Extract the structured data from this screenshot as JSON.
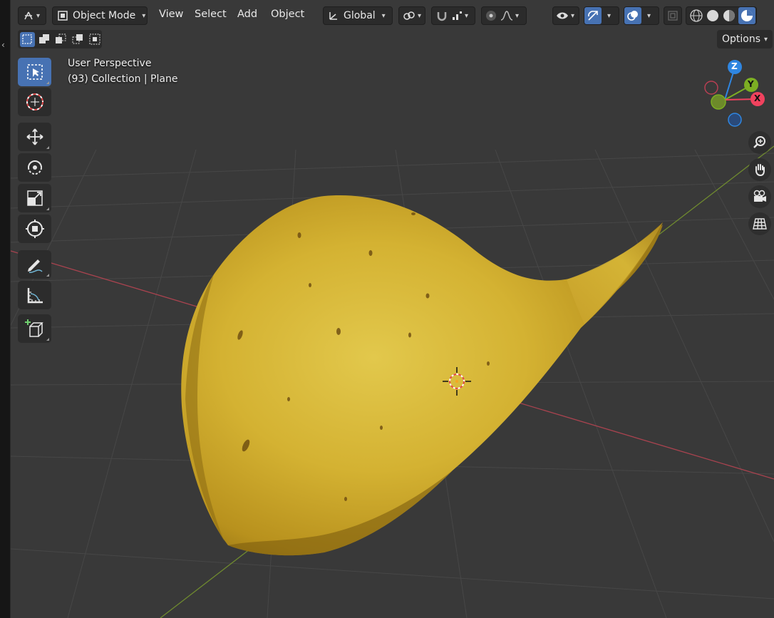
{
  "header": {
    "mode_label": "Object Mode",
    "menus": [
      "View",
      "Select",
      "Add",
      "Object"
    ],
    "orientation_label": "Global",
    "options_label": "Options"
  },
  "overlay": {
    "view_name": "User Perspective",
    "collection_info": "(93) Collection | Plane"
  },
  "gizmo": {
    "z_label": "Z",
    "y_label": "Y",
    "x_label": "X",
    "colors": {
      "x": "#f0425e",
      "y": "#7cae23",
      "z": "#2f86e1"
    }
  },
  "colors": {
    "viewport_bg": "#393939",
    "active_tool": "#4772b3",
    "chip_yellow": "#d8b530",
    "x_axis_line": "#a9434f",
    "y_axis_line": "#6f8a2f"
  },
  "tools": [
    "select-box",
    "cursor",
    "move",
    "rotate",
    "scale",
    "transform",
    "annotate",
    "measure",
    "add-cube"
  ],
  "nav_buttons": [
    "zoom",
    "pan",
    "camera",
    "ortho-grid"
  ],
  "object": {
    "name": "Plane",
    "material": "potato chip texture"
  }
}
